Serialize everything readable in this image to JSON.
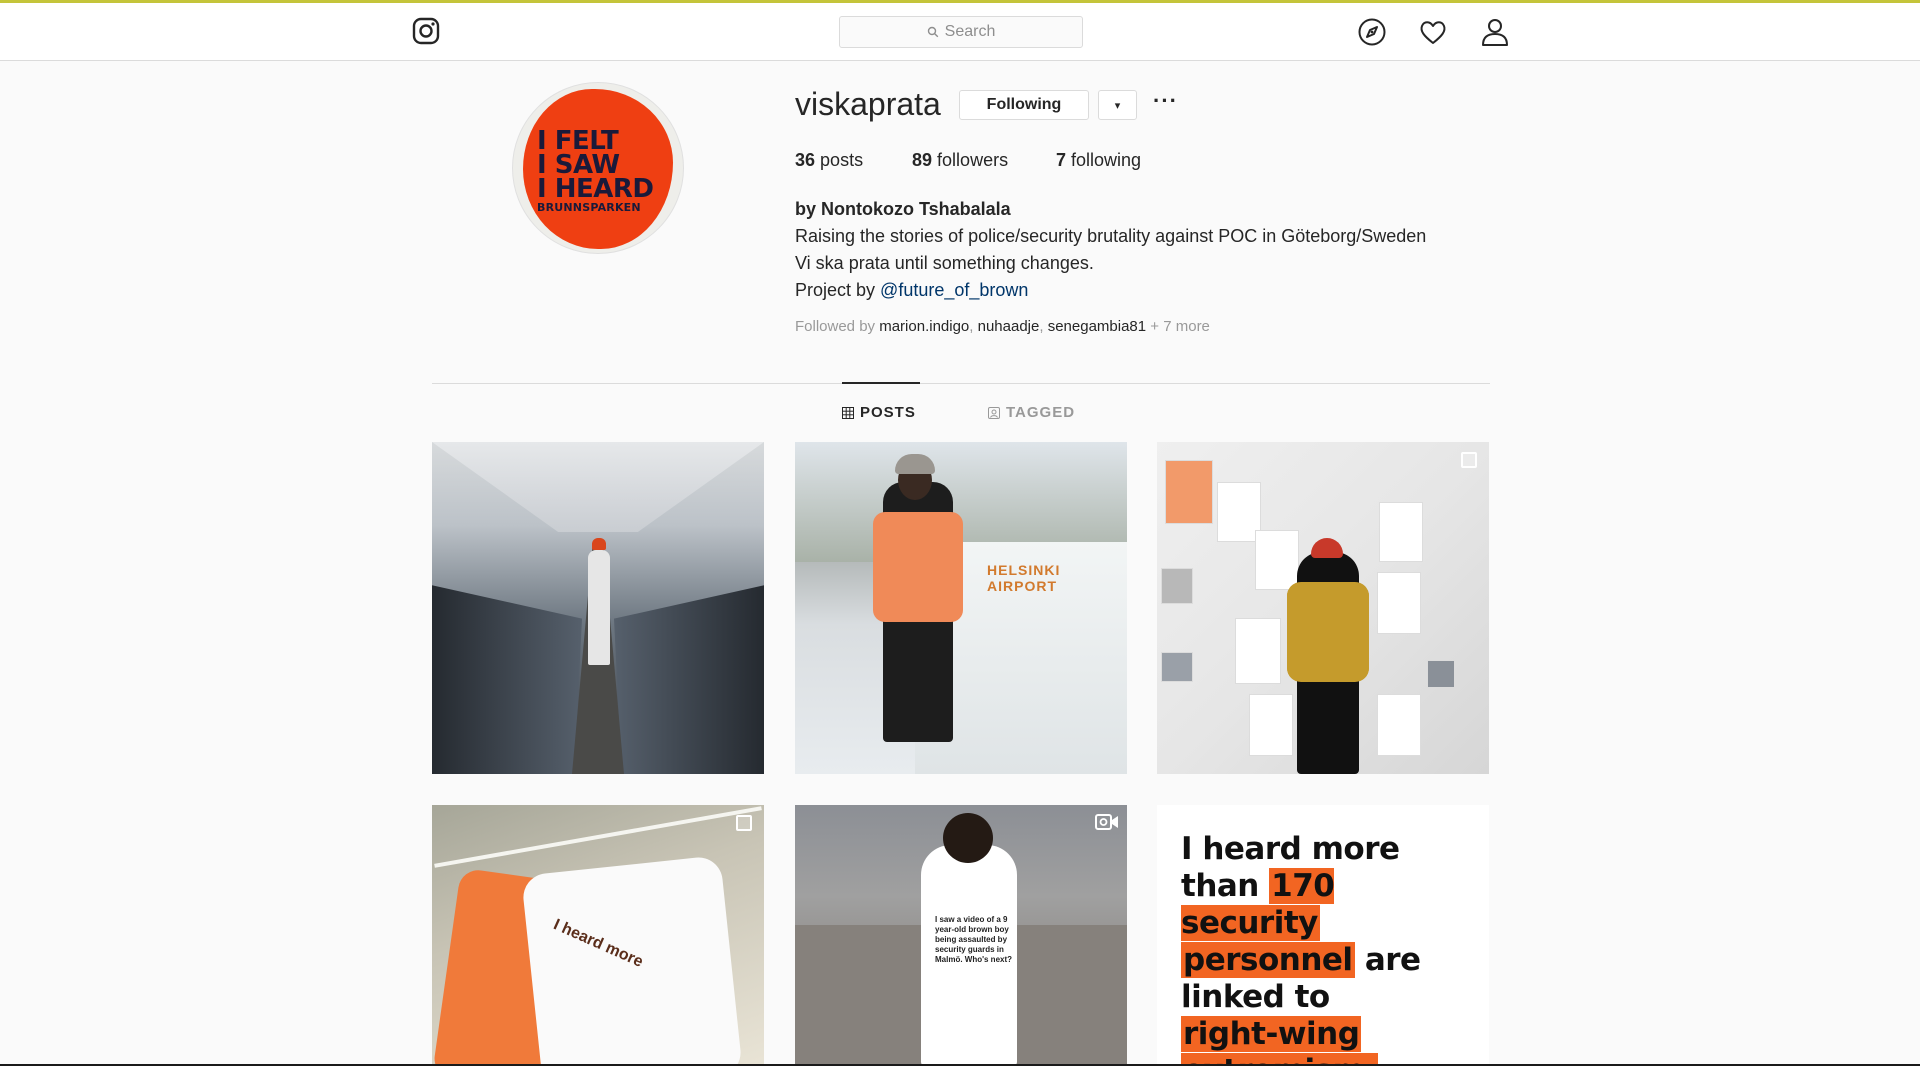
{
  "header": {
    "logo_icon": "instagram-camera-icon",
    "search_placeholder": "Search",
    "nav_icons": [
      "compass-icon",
      "heart-icon",
      "user-icon"
    ]
  },
  "profile": {
    "username": "viskaprata",
    "avatar_text": [
      "I FELT",
      "I SAW",
      "I HEARD",
      "BRUNNSPARKEN"
    ],
    "following_button": "Following",
    "dropdown_glyph": "▾",
    "more_glyph": "···",
    "stats": {
      "posts_count": "36",
      "posts_label": "posts",
      "followers_count": "89",
      "followers_label": "followers",
      "following_count": "7",
      "following_label": "following"
    },
    "bio": {
      "name": "by Nontokozo Tshabalala",
      "line1": "Raising the stories of police/security brutality against POC in Göteborg/Sweden",
      "line2": "Vi ska prata until something changes.",
      "line3_prefix": "Project by ",
      "line3_mention": "@future_of_brown"
    },
    "followed_by": {
      "prefix": "Followed by ",
      "user1": "marion.indigo",
      "sep1": ", ",
      "user2": "nuhaadje",
      "sep2": ", ",
      "user3": "senegambia81",
      "suffix": " + 7 more"
    }
  },
  "tabs": {
    "posts": "POSTS",
    "tagged": "TAGGED",
    "active": "posts"
  },
  "posts": {
    "tile2_sign": "HELSINKI AIRPORT",
    "tile4_shirt_text": "I heard more",
    "tile5_shirt_text": "I saw a video of a 9 year-old brown boy being assaulted by security guards in Malmö. Who's next?",
    "tile6_lines": [
      "I heard more",
      "than ",
      "170 security",
      "personnel",
      " are",
      "linked to",
      "right-wing",
      "extremism."
    ]
  },
  "colors": {
    "accent_orange": "#f26522",
    "link_blue": "#003569",
    "muted_gray": "#999999"
  }
}
